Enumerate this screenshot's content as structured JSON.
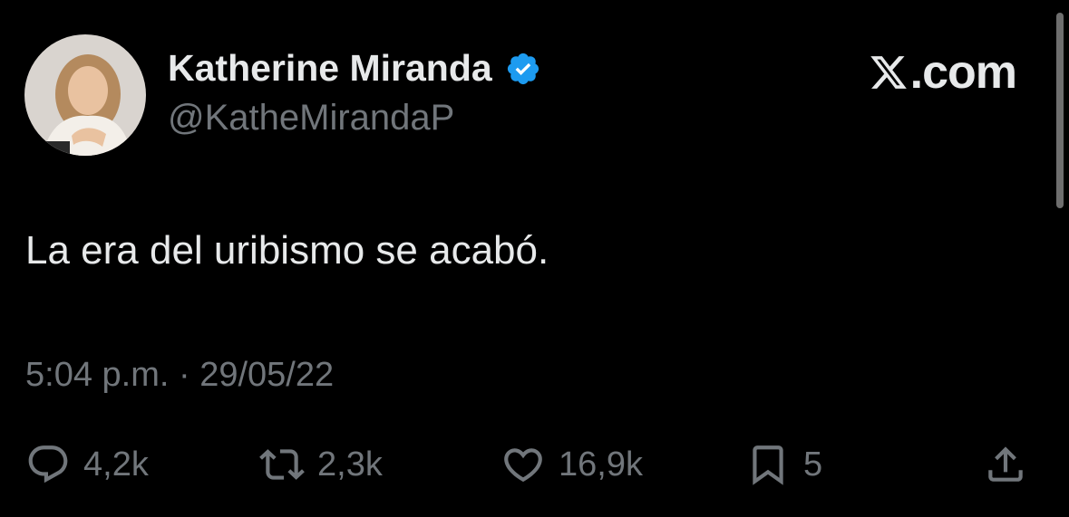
{
  "author": {
    "display_name": "Katherine Miranda",
    "handle": "@KatheMirandaP",
    "verified": true
  },
  "brand": {
    "label": ".com",
    "logo_icon": "x-logo-icon"
  },
  "tweet": {
    "text": "La era del uribismo se acabó.",
    "timestamp": "5:04 p.m. · 29/05/22"
  },
  "actions": {
    "reply_count": "4,2k",
    "retweet_count": "2,3k",
    "like_count": "16,9k",
    "bookmark_count": "5"
  },
  "colors": {
    "background": "#000000",
    "primary_text": "#e7e9ea",
    "secondary_text": "#71767b",
    "verified_blue": "#1d9bf0"
  }
}
